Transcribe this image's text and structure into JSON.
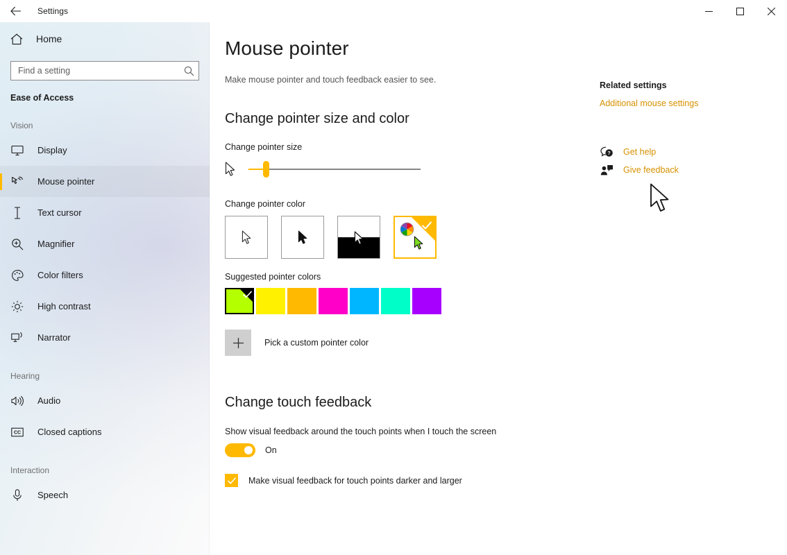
{
  "window": {
    "title": "Settings",
    "back_icon": "back-arrow-icon",
    "minimize_label": "—",
    "maximize_label": "□",
    "close_label": "✕"
  },
  "sidebar": {
    "home_label": "Home",
    "home_icon": "home-icon",
    "search": {
      "placeholder": "Find a setting",
      "value": "",
      "icon": "search-icon"
    },
    "category": "Ease of Access",
    "groups": [
      {
        "label": "Vision",
        "items": [
          {
            "label": "Display",
            "icon": "monitor-icon",
            "selected": false
          },
          {
            "label": "Mouse pointer",
            "icon": "pointer-hand-icon",
            "selected": true
          },
          {
            "label": "Text cursor",
            "icon": "text-cursor-icon",
            "selected": false
          },
          {
            "label": "Magnifier",
            "icon": "magnifier-icon",
            "selected": false
          },
          {
            "label": "Color filters",
            "icon": "palette-icon",
            "selected": false
          },
          {
            "label": "High contrast",
            "icon": "brightness-icon",
            "selected": false
          },
          {
            "label": "Narrator",
            "icon": "narrator-icon",
            "selected": false
          }
        ]
      },
      {
        "label": "Hearing",
        "items": [
          {
            "label": "Audio",
            "icon": "speaker-icon",
            "selected": false
          },
          {
            "label": "Closed captions",
            "icon": "closed-captions-icon",
            "selected": false
          }
        ]
      },
      {
        "label": "Interaction",
        "items": [
          {
            "label": "Speech",
            "icon": "microphone-icon",
            "selected": false
          }
        ]
      }
    ]
  },
  "main": {
    "page_title": "Mouse pointer",
    "subtitle": "Make mouse pointer and touch feedback easier to see.",
    "section_pointer": "Change pointer size and color",
    "pointer_size": {
      "label": "Change pointer size",
      "value": 1,
      "min": 1,
      "max": 15,
      "fill_percent": 8,
      "small_preview_icon": "pointer-small-icon",
      "large_preview_icon": "pointer-large-icon"
    },
    "pointer_color": {
      "label": "Change pointer color",
      "options": [
        {
          "name": "white-pointer",
          "selected": false
        },
        {
          "name": "black-pointer",
          "selected": false
        },
        {
          "name": "inverted-pointer",
          "selected": false
        },
        {
          "name": "custom-color-pointer",
          "selected": true
        }
      ],
      "selection_accent": "#ffb900"
    },
    "suggested_colors": {
      "label": "Suggested pointer colors",
      "swatches": [
        {
          "name": "green-yellow",
          "hex": "#B4FF00",
          "selected": true
        },
        {
          "name": "yellow",
          "hex": "#FFF100",
          "selected": false
        },
        {
          "name": "amber",
          "hex": "#FFB900",
          "selected": false
        },
        {
          "name": "magenta",
          "hex": "#FF00C8",
          "selected": false
        },
        {
          "name": "sky-blue",
          "hex": "#00B7FF",
          "selected": false
        },
        {
          "name": "turquoise",
          "hex": "#00FFC8",
          "selected": false
        },
        {
          "name": "violet",
          "hex": "#A800FF",
          "selected": false
        }
      ]
    },
    "custom_color": {
      "label": "Pick a custom pointer color",
      "icon": "plus-icon"
    },
    "section_touch": "Change touch feedback",
    "touch_toggle": {
      "description": "Show visual feedback around the touch points when I touch the screen",
      "state_label": "On",
      "on": true
    },
    "touch_checkbox": {
      "label": "Make visual feedback for touch points darker and larger",
      "checked": true
    }
  },
  "rail": {
    "related_heading": "Related settings",
    "related_link": "Additional mouse settings",
    "help_links": [
      {
        "label": "Get help",
        "icon": "help-chat-icon"
      },
      {
        "label": "Give feedback",
        "icon": "feedback-person-icon"
      }
    ],
    "link_color": "#d69100"
  }
}
